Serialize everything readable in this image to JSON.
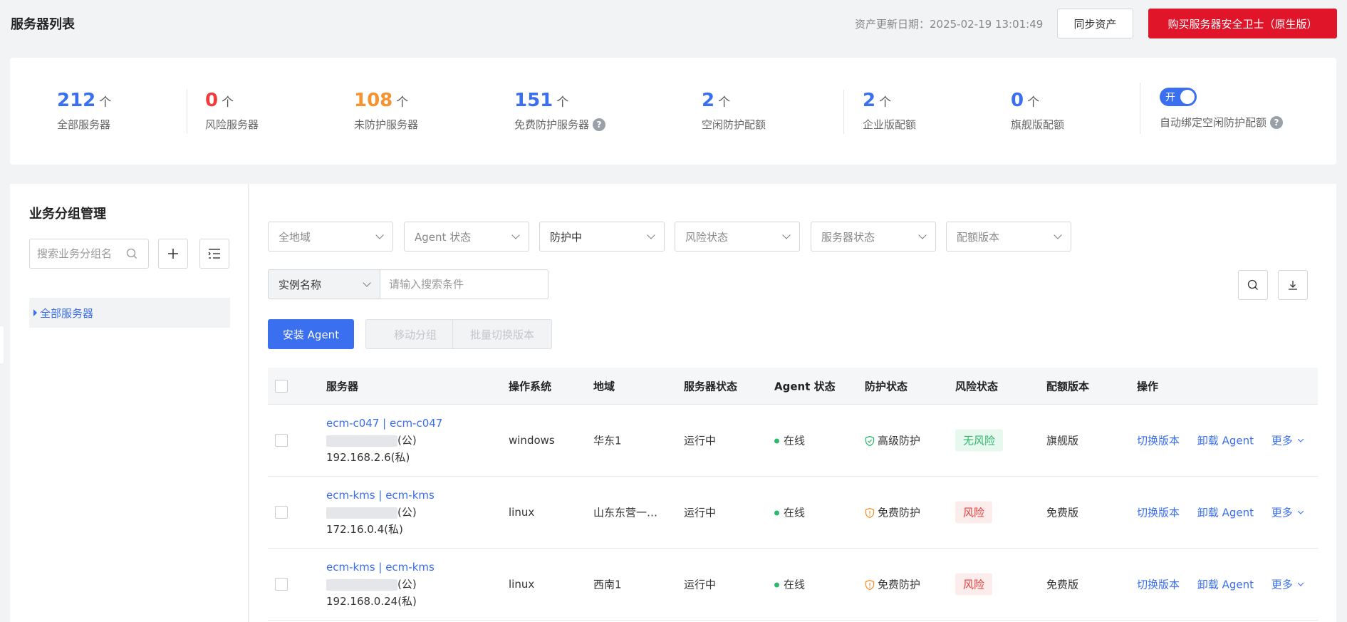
{
  "header": {
    "title": "服务器列表",
    "asset_date": "资产更新日期：2025-02-19 13:01:49",
    "sync_label": "同步资产",
    "buy_label": "购买服务器安全卫士（原生版）"
  },
  "stats": [
    {
      "value": "212",
      "unit": "个",
      "label": "全部服务器",
      "color": "#3a6ff0"
    },
    {
      "value": "0",
      "unit": "个",
      "label": "风险服务器",
      "color": "#f23c3c"
    },
    {
      "value": "108",
      "unit": "个",
      "label": "未防护服务器",
      "color": "#f7932e"
    },
    {
      "value": "151",
      "unit": "个",
      "label": "免费防护服务器",
      "color": "#3a6ff0"
    },
    {
      "value": "2",
      "unit": "个",
      "label": "空闲防护配额",
      "color": "#3a6ff0"
    },
    {
      "value": "2",
      "unit": "个",
      "label": "企业版配额",
      "color": "#3a6ff0"
    },
    {
      "value": "0",
      "unit": "个",
      "label": "旗舰版配额",
      "color": "#3a6ff0"
    }
  ],
  "auto_bind": {
    "toggle_label": "开",
    "label": "自动绑定空闲防护配额"
  },
  "sidebar": {
    "title": "业务分组管理",
    "search_placeholder": "搜索业务分组名",
    "tree": [
      {
        "label": "全部服务器"
      }
    ]
  },
  "filters": {
    "region": "全地域",
    "agent_status": "Agent 状态",
    "protection": "防护中",
    "risk_status": "风险状态",
    "server_status": "服务器状态",
    "quota_version": "配额版本",
    "search_field": "实例名称",
    "search_placeholder": "请输入搜索条件"
  },
  "actions": {
    "install": "安装 Agent",
    "move_group": "移动分组",
    "batch_switch": "批量切换版本"
  },
  "table": {
    "columns": [
      "服务器",
      "操作系统",
      "地域",
      "服务器状态",
      "Agent 状态",
      "防护状态",
      "风险状态",
      "配额版本",
      "操作"
    ],
    "rows": [
      {
        "name": "ecm-c047 | ecm-c047",
        "public_suffix": "(公)",
        "private_ip": "192.168.2.6(私)",
        "os": "windows",
        "region": "华东1",
        "status": "运行中",
        "agent": "在线",
        "protection": "高级防护",
        "risk": "无风险",
        "risk_type": "safe",
        "quota": "旗舰版",
        "op_switch": "切换版本",
        "op_uninstall": "卸载 Agent",
        "op_more": "更多"
      },
      {
        "name": "ecm-kms | ecm-kms",
        "public_suffix": "(公)",
        "private_ip": "172.16.0.4(私)",
        "os": "linux",
        "region": "山东东营一…",
        "status": "运行中",
        "agent": "在线",
        "protection": "免费防护",
        "risk": "风险",
        "risk_type": "risk",
        "quota": "免费版",
        "op_switch": "切换版本",
        "op_uninstall": "卸载 Agent",
        "op_more": "更多"
      },
      {
        "name": "ecm-kms | ecm-kms",
        "public_suffix": "(公)",
        "private_ip": "192.168.0.24(私)",
        "os": "linux",
        "region": "西南1",
        "status": "运行中",
        "agent": "在线",
        "protection": "免费防护",
        "risk": "风险",
        "risk_type": "risk",
        "quota": "免费版",
        "op_switch": "切换版本",
        "op_uninstall": "卸载 Agent",
        "op_more": "更多"
      }
    ]
  }
}
